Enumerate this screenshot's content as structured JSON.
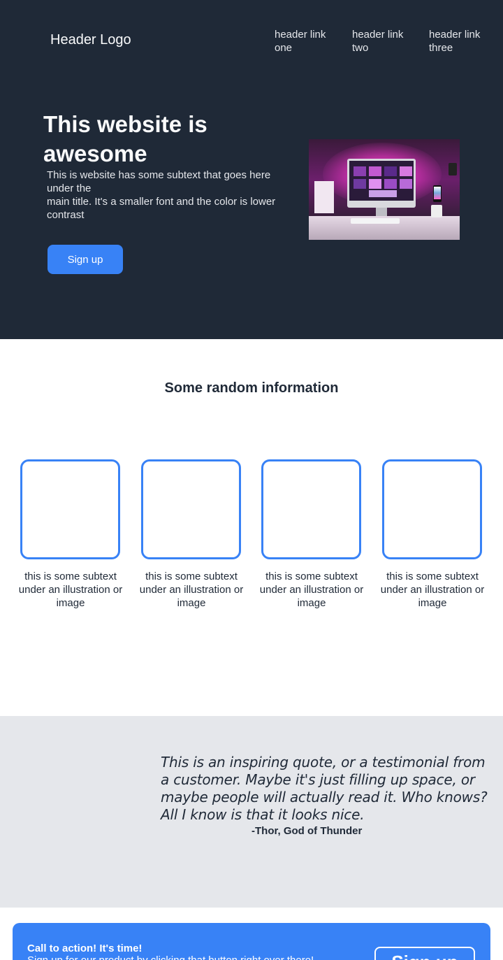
{
  "header": {
    "logo": "Header Logo",
    "links": [
      "header link one",
      "header link two",
      "header link three"
    ]
  },
  "hero": {
    "title": "This website is awesome",
    "subtext_line1": "This is website has some subtext that goes here under the",
    "subtext_line2": "main title. It's a smaller font and the color is lower contrast",
    "button_label": "Sign up",
    "image_alt": "desk setup with monitor and pink lighting"
  },
  "info": {
    "title": "Some random information",
    "cards": [
      {
        "text": "this is some subtext under an illustration or image"
      },
      {
        "text": "this is some subtext under an illustration or image"
      },
      {
        "text": "this is some subtext under an illustration or image"
      },
      {
        "text": "this is some subtext under an illustration or image"
      }
    ]
  },
  "quote": {
    "text": "This is an inspiring quote, or a testimonial from a customer. Maybe it's just filling up space, or maybe people will actually read it. Who knows? All I know is that it looks nice.",
    "author": "-Thor, God of Thunder"
  },
  "cta": {
    "title": "Call to action! It's time!",
    "subtext": "Sign up for our product by clicking that button right over there!",
    "button_label": "Sign up"
  },
  "colors": {
    "hero_bg": "#1f2937",
    "accent": "#3882f6",
    "quote_bg": "#e5e7eb"
  }
}
